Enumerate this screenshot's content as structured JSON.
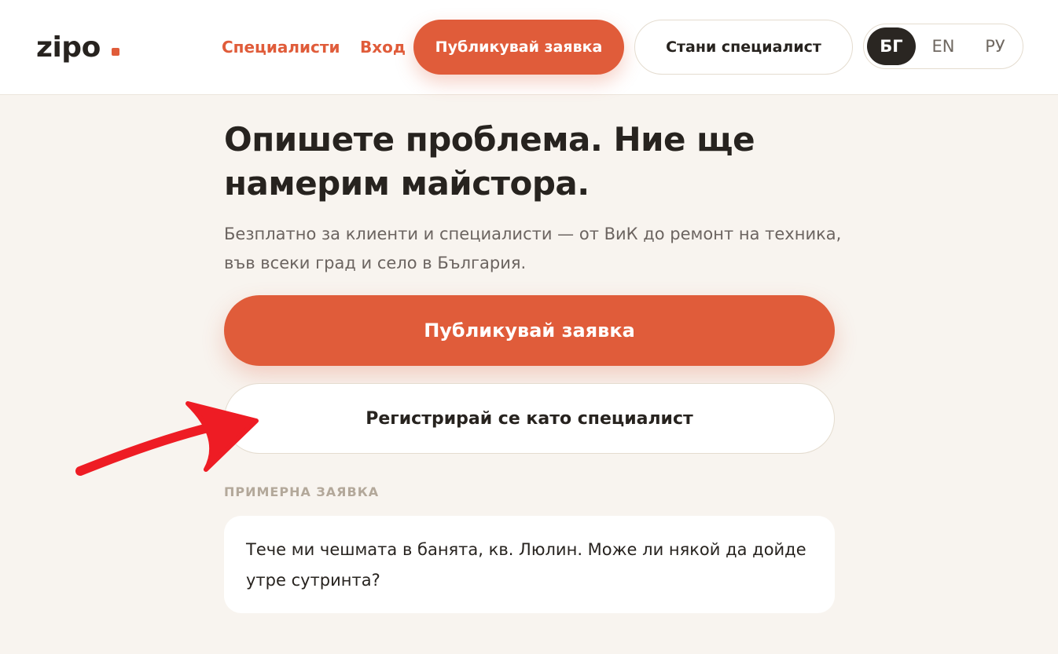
{
  "header": {
    "logo_text": "zipo",
    "nav": {
      "specialists": "Специалисти",
      "login": "Вход"
    },
    "publish_button": "Публикувай заявка",
    "become_specialist_button": "Стани специалист",
    "languages": [
      "БГ",
      "EN",
      "РУ"
    ],
    "active_language": "БГ"
  },
  "hero": {
    "headline": "Опишете проблема. Ние ще намерим майстора.",
    "subtitle": "Безплатно за клиенти и специалисти — от ВиК до ремонт на техника, във всеки град и село в България.",
    "publish_button": "Публикувай заявка",
    "register_button": "Регистрирай се като специалист"
  },
  "example": {
    "label": "ПРИМЕРНА ЗАЯВКА",
    "text": "Тече ми чешмата в банята, кв. Люлин. Може ли някой да дойде утре сутринта?"
  },
  "colors": {
    "accent": "#e05c3a",
    "background": "#f8f4ef",
    "dark": "#27231f",
    "annotation_arrow": "#ee1c24"
  },
  "icons": {
    "annotation": "red-arrow-icon"
  }
}
